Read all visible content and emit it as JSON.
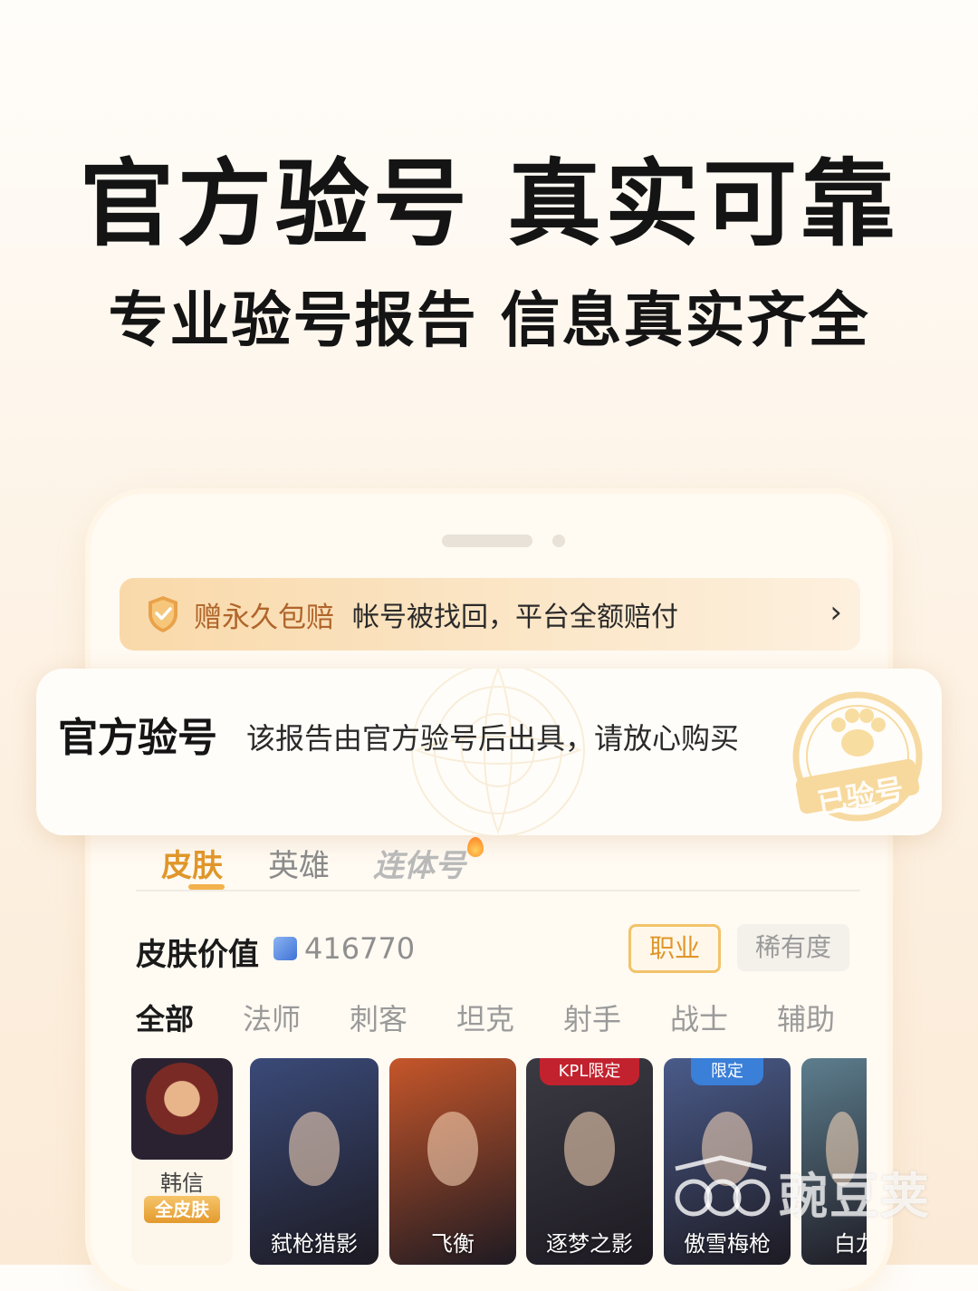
{
  "headline": {
    "title": "官方验号 真实可靠",
    "subtitle": "专业验号报告 信息真实齐全"
  },
  "banner": {
    "title": "赠永久包赔",
    "text": "帐号被找回，平台全额赔付",
    "arrow": "›"
  },
  "overlay": {
    "title": "官方验号",
    "text": "该报告由官方验号后出具，请放心购买",
    "stamp_text": "已验号"
  },
  "tabs": [
    {
      "label": "皮肤"
    },
    {
      "label": "英雄"
    },
    {
      "label": "连体号"
    }
  ],
  "value_row": {
    "label": "皮肤价值",
    "value": "416770",
    "job_button": "职业",
    "rarity_button": "稀有度"
  },
  "categories": [
    {
      "label": "全部"
    },
    {
      "label": "法师"
    },
    {
      "label": "刺客"
    },
    {
      "label": "坦克"
    },
    {
      "label": "射手"
    },
    {
      "label": "战士"
    },
    {
      "label": "辅助"
    }
  ],
  "hero": {
    "name": "韩信",
    "tag": "全皮肤"
  },
  "skins": [
    {
      "name": "弑枪猎影",
      "color": "#3a4a78"
    },
    {
      "name": "飞衡",
      "color": "#c6562a"
    },
    {
      "name": "逐梦之影",
      "color": "#3b3a42",
      "badge": "KPL限定"
    },
    {
      "name": "傲雪梅枪",
      "color": "#4a5b8a",
      "badge": "限定"
    },
    {
      "name": "白龙",
      "color": "#5d7e8e"
    }
  ],
  "watermark": {
    "text": "豌豆荚"
  },
  "colors": {
    "accent": "#e0962a",
    "banner_bg": "#f9d9aa",
    "tag_bg": "#e39a2d"
  }
}
